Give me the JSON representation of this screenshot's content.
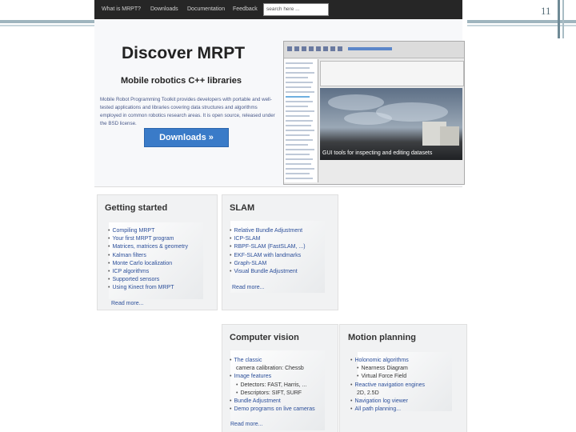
{
  "slide": {
    "number": "11"
  },
  "nav": {
    "items": [
      "What is MRPT?",
      "Downloads",
      "Documentation",
      "Feedback"
    ],
    "search_placeholder": "search here ..."
  },
  "hero": {
    "title": "Discover MRPT",
    "subtitle": "Mobile robotics C++ libraries",
    "description": "Mobile Robot Programming Toolkit provides developers with portable and well-tested applications and libraries covering data structures and algorithms employed in common robotics research areas. It is open source, released under the BSD license.",
    "download_label": "Downloads »",
    "app_caption": "GUI tools for inspecting and editing datasets"
  },
  "sections": {
    "getting_started": {
      "title": "Getting started",
      "items": [
        "Compiling MRPT",
        "Your first MRPT program",
        "Matrices, matrices & geometry",
        "Kalman filters",
        "Monte Carlo localization",
        "ICP algorithms",
        "Supported sensors",
        "Using Kinect from MRPT"
      ],
      "read_more": "Read more..."
    },
    "slam": {
      "title": "SLAM",
      "items": [
        "Relative Bundle Adjustment",
        "ICP-SLAM",
        "RBPF-SLAM (FastSLAM, ...)",
        "EKF-SLAM with landmarks",
        "Graph-SLAM",
        "Visual Bundle Adjustment"
      ],
      "read_more": "Read more..."
    },
    "computer_vision": {
      "title": "Computer vision",
      "items": [
        {
          "text": "The classic",
          "sub": false
        },
        {
          "text": "camera calibration: Chessb",
          "sub": true
        },
        {
          "text": "Image features",
          "sub": false
        },
        {
          "text": "Detectors: FAST, Harris, ...",
          "sub": true
        },
        {
          "text": "Descriptors: SIFT, SURF",
          "sub": true
        },
        {
          "text": "Bundle Adjustment",
          "sub": false
        },
        {
          "text": "Demo programs on live cameras",
          "sub": false
        }
      ],
      "read_more": "Read more..."
    },
    "motion_planning": {
      "title": "Motion planning",
      "items": [
        {
          "text": "Holonomic algorithms",
          "sub": false
        },
        {
          "text": "Nearness Diagram",
          "sub": true
        },
        {
          "text": "Virtual Force Field",
          "sub": true
        },
        {
          "text": "Reactive navigation engines",
          "sub": false
        },
        {
          "text": "2D, 2.5D",
          "sub": true
        },
        {
          "text": "Navigation log viewer",
          "sub": false
        },
        {
          "text": "All path planning...",
          "sub": false
        }
      ]
    }
  }
}
